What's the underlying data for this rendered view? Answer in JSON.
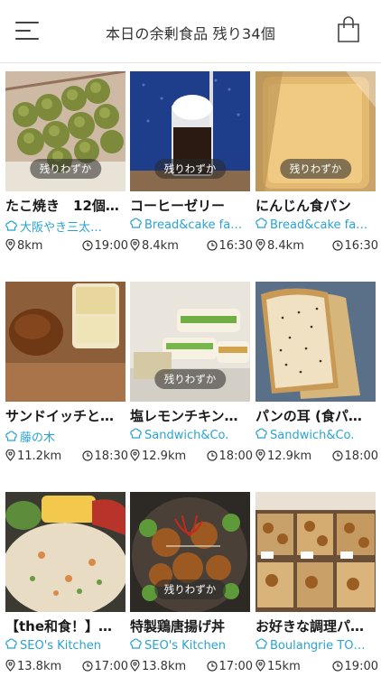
{
  "header": {
    "title": "本日の余剰食品 残り34個",
    "menu_icon": "hamburger-icon",
    "cart_icon": "shopping-bag-icon"
  },
  "colors": {
    "shop_link": "#29a3d4",
    "badge_bg": "#383838"
  },
  "items": [
    {
      "name": "たこ焼き　12個…",
      "shop": "大阪やき三太…",
      "distance": "8km",
      "time": "19:00",
      "badge": "残りわずか",
      "image": "takoyaki"
    },
    {
      "name": "コーヒーゼリー",
      "shop": "Bread&cake fa…",
      "distance": "8.4km",
      "time": "16:30",
      "badge": "残りわずか",
      "image": "coffee-jelly"
    },
    {
      "name": "にんじん食パン",
      "shop": "Bread&cake fa…",
      "distance": "8.4km",
      "time": "16:30",
      "badge": "残りわずか",
      "image": "carrot-bread"
    },
    {
      "name": "サンドイッチと…",
      "shop": "藤の木",
      "distance": "11.2km",
      "time": "18:30",
      "badge": "",
      "image": "sandwich-bun"
    },
    {
      "name": "塩レモンチキン…",
      "shop": "Sandwich&Co.",
      "distance": "12.9km",
      "time": "18:00",
      "badge": "残りわずか",
      "image": "lemon-chicken-sandwich"
    },
    {
      "name": "パンの耳 (食パ…",
      "shop": "Sandwich&Co.",
      "distance": "12.9km",
      "time": "18:00",
      "badge": "",
      "image": "bread-slices"
    },
    {
      "name": "【the和食！】…",
      "shop": "SEO's Kitchen",
      "distance": "13.8km",
      "time": "17:00",
      "badge": "",
      "image": "washoku-rice"
    },
    {
      "name": "特製鶏唐揚げ丼",
      "shop": "SEO's Kitchen",
      "distance": "13.8km",
      "time": "17:00",
      "badge": "残りわずか",
      "image": "karaage-don"
    },
    {
      "name": "お好きな調理パ…",
      "shop": "Boulangrie TO…",
      "distance": "15km",
      "time": "19:00",
      "badge": "",
      "image": "bakery-shelf"
    }
  ]
}
